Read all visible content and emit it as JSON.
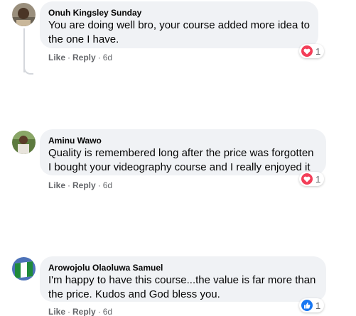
{
  "comments": [
    {
      "author": "Onuh Kingsley Sunday",
      "text": "You are doing well bro, your course added more idea to\nthe one I have.",
      "like_label": "Like",
      "reply_label": "Reply",
      "time": "6d",
      "reaction": "love",
      "reaction_count": "1"
    },
    {
      "author": "Aminu Wawo",
      "text": "Quality is remembered long after the price was forgotten\nI bought your videography course and I really enjoyed it",
      "like_label": "Like",
      "reply_label": "Reply",
      "time": "6d",
      "reaction": "love",
      "reaction_count": "1"
    },
    {
      "author": "Arowojolu Olaoluwa Samuel",
      "text": "I'm happy to have this course...the value is far more than\nthe price. Kudos and God bless you.",
      "like_label": "Like",
      "reply_label": "Reply",
      "time": "6d",
      "reaction": "like",
      "reaction_count": "1"
    }
  ],
  "separator": "·",
  "colors": {
    "bubble": "#f0f2f5",
    "love": "#f33e58",
    "like": "#1877f2",
    "meta": "#65676b"
  }
}
